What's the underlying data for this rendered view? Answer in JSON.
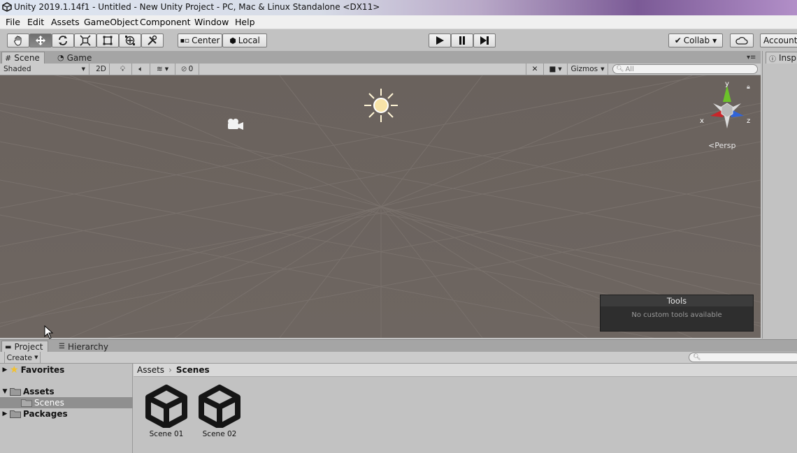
{
  "window": {
    "title": "Unity 2019.1.14f1 - Untitled - New Unity Project - PC, Mac & Linux Standalone <DX11>"
  },
  "menu": [
    "File",
    "Edit",
    "Assets",
    "GameObject",
    "Component",
    "Window",
    "Help"
  ],
  "toolbar": {
    "transform_tools": [
      "hand-icon",
      "move-icon",
      "rotate-icon",
      "scale-icon",
      "rect-icon",
      "transform-icon",
      "custom-tool-icon"
    ],
    "pivot_label": "Center",
    "space_label": "Local",
    "play_icons": [
      "play-icon",
      "pause-icon",
      "step-icon"
    ],
    "collab_label": "Collab",
    "account_label": "Account"
  },
  "scene_panel": {
    "tabs": [
      {
        "label": "Scene",
        "active": true
      },
      {
        "label": "Game",
        "active": false
      }
    ],
    "shading": "Shaded",
    "mode_2d": "2D",
    "hidden_count": "0",
    "gizmos_label": "Gizmos",
    "search_placeholder": "All",
    "persp_label": "Persp",
    "axis_labels": {
      "x": "x",
      "y": "y",
      "z": "z"
    }
  },
  "tools_overlay": {
    "title": "Tools",
    "message": "No custom tools available"
  },
  "inspector": {
    "tab_label": "Insp"
  },
  "bottom_panel": {
    "tabs": [
      {
        "label": "Project",
        "active": true
      },
      {
        "label": "Hierarchy",
        "active": false
      }
    ],
    "create_label": "Create",
    "tree": {
      "favorites": "Favorites",
      "assets": "Assets",
      "scenes": "Scenes",
      "packages": "Packages"
    },
    "breadcrumb": [
      "Assets",
      "Scenes"
    ],
    "assets": [
      "Scene 01",
      "Scene 02"
    ]
  },
  "colors": {
    "viewport_bg": "#6a625d",
    "editor_bg": "#c2c2c2",
    "axis_x": "#c8262a",
    "axis_y": "#6cc22a",
    "axis_z": "#3164d8"
  }
}
